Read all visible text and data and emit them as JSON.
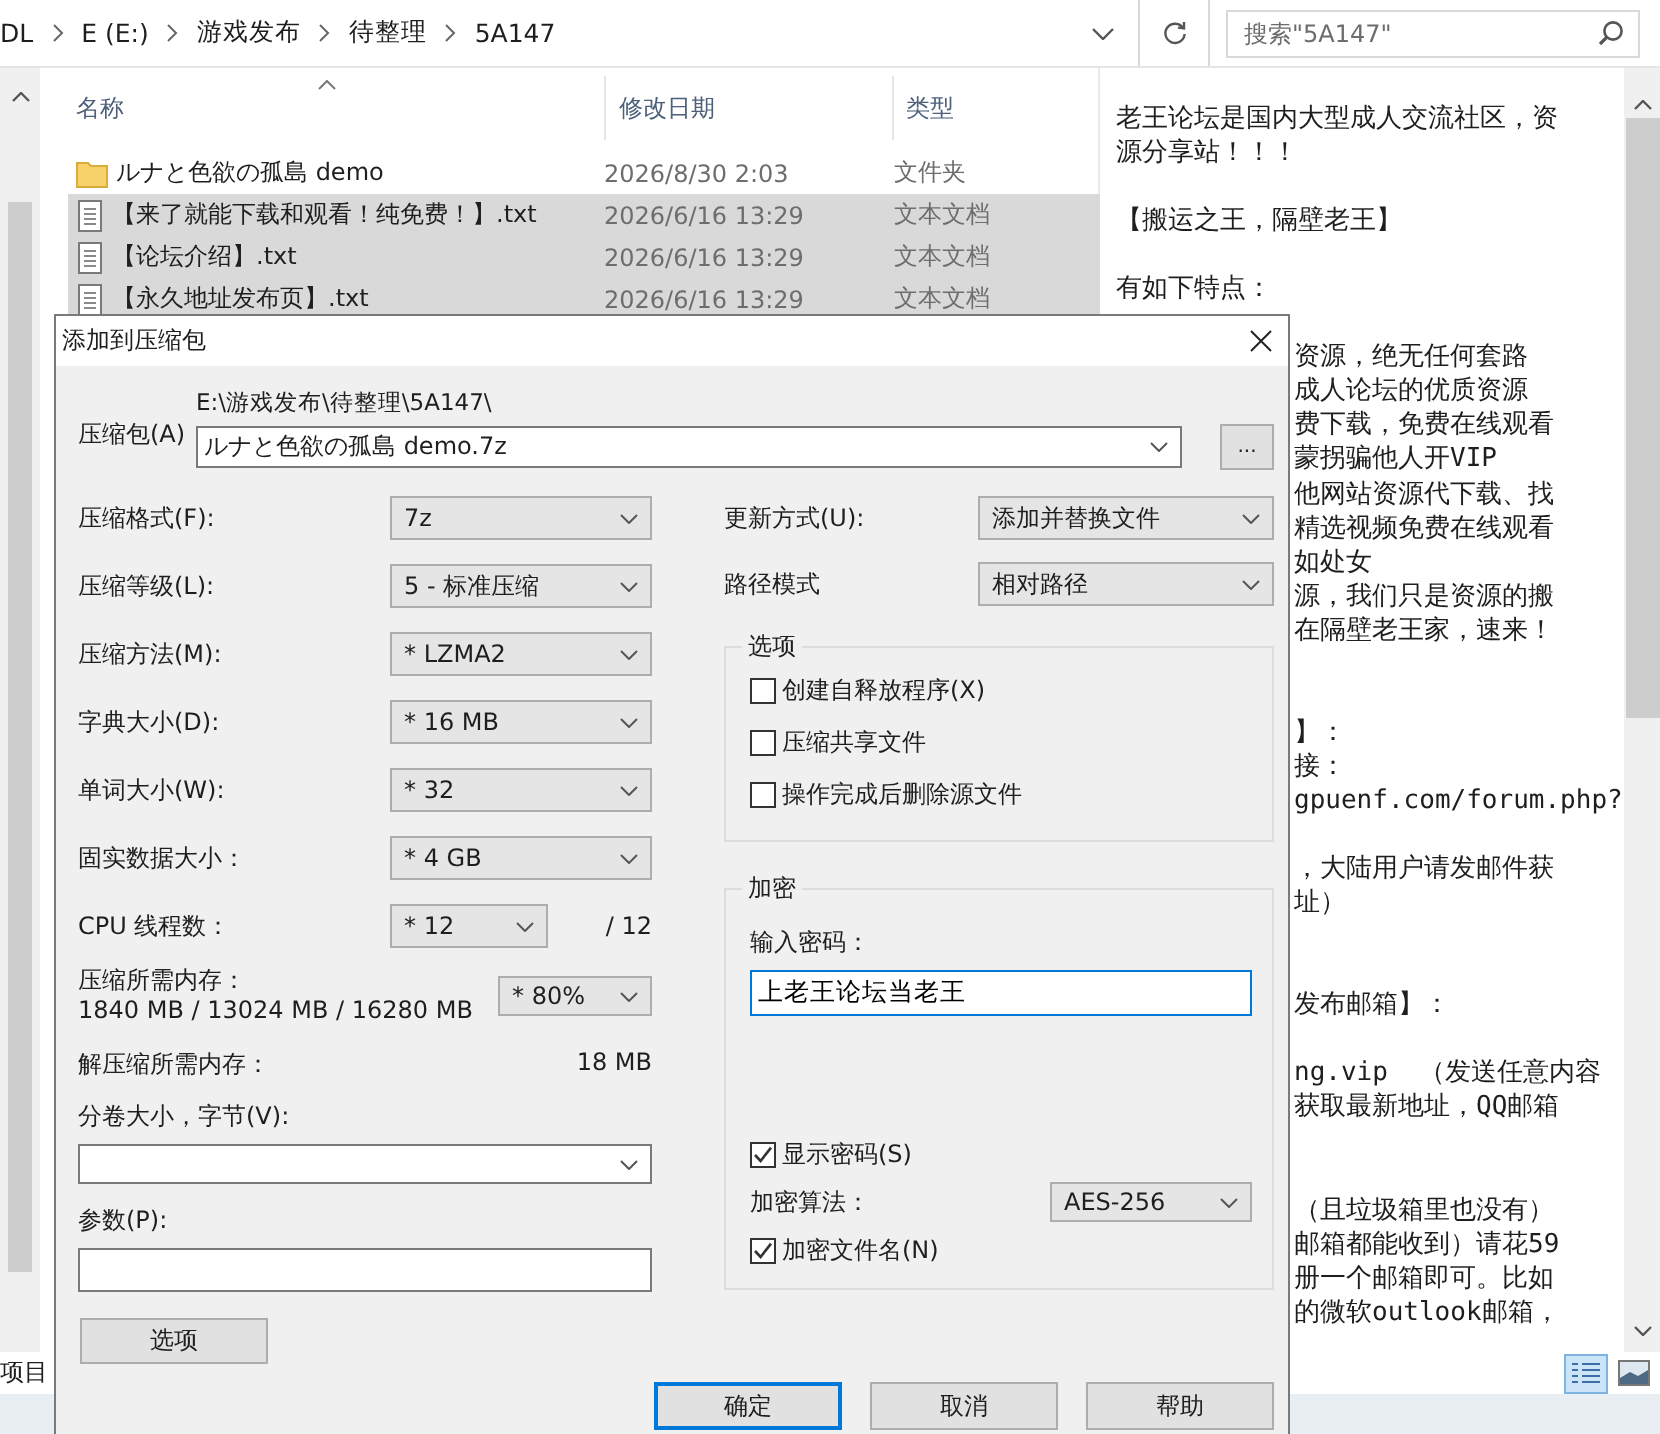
{
  "explorer": {
    "breadcrumb": [
      {
        "label": "DL"
      },
      {
        "label": "E (E:)"
      },
      {
        "label": "游戏发布"
      },
      {
        "label": "待整理"
      },
      {
        "label": "5A147"
      }
    ],
    "search": {
      "placeholder": "搜索\"5A147\""
    },
    "columns": [
      {
        "label": "名称",
        "sorted": true
      },
      {
        "label": "修改日期",
        "sorted": false
      },
      {
        "label": "类型",
        "sorted": false
      }
    ],
    "files": [
      {
        "name": "ルナと色欲の孤島 demo",
        "modified": "2026/8/30 2:03",
        "type": "文件夹",
        "kind": "folder",
        "selected": false
      },
      {
        "name": "【来了就能下载和观看！纯免费！】.txt",
        "modified": "2026/6/16 13:29",
        "type": "文本文档",
        "kind": "text",
        "selected": true
      },
      {
        "name": "【论坛介绍】.txt",
        "modified": "2026/6/16 13:29",
        "type": "文本文档",
        "kind": "text",
        "selected": true
      },
      {
        "name": "【永久地址发布页】.txt",
        "modified": "2026/6/16 13:29",
        "type": "文本文档",
        "kind": "text",
        "selected": true
      }
    ],
    "status_text": "项目",
    "preview": {
      "lines": [
        {
          "kind": "full",
          "text": "老王论坛是国内大型成人交流社区，资"
        },
        {
          "kind": "full",
          "text": "源分享站！！！"
        },
        {
          "kind": "blank"
        },
        {
          "kind": "full",
          "text": "【搬运之王，隔壁老王】"
        },
        {
          "kind": "blank"
        },
        {
          "kind": "full",
          "text": "有如下特点："
        },
        {
          "kind": "blank"
        },
        {
          "kind": "clipped",
          "text": "资源，绝无任何套路"
        },
        {
          "kind": "clipped",
          "text": "成人论坛的优质资源"
        },
        {
          "kind": "clipped",
          "text": "费下载，免费在线观看"
        },
        {
          "kind": "clipped",
          "text": "蒙拐骗他人开VIP"
        },
        {
          "kind": "clipped",
          "text": "他网站资源代下载、找"
        },
        {
          "kind": "clipped",
          "text": "精选视频免费在线观看"
        },
        {
          "kind": "clipped",
          "text": "如处女"
        },
        {
          "kind": "clipped",
          "text": "源，我们只是资源的搬"
        },
        {
          "kind": "clipped",
          "text": "在隔壁老王家，速来！"
        },
        {
          "kind": "blank"
        },
        {
          "kind": "blank"
        },
        {
          "kind": "clipped",
          "text": "】："
        },
        {
          "kind": "clipped",
          "text": "接："
        },
        {
          "kind": "clipped",
          "text": "gpuenf.com/forum.php?"
        },
        {
          "kind": "blank"
        },
        {
          "kind": "clipped",
          "text": "，大陆用户请发邮件获"
        },
        {
          "kind": "clipped",
          "text": "址）"
        },
        {
          "kind": "blank"
        },
        {
          "kind": "blank"
        },
        {
          "kind": "clipped",
          "text": "发布邮箱】："
        },
        {
          "kind": "blank"
        },
        {
          "kind": "clipped",
          "text": "ng.vip  （发送任意内容"
        },
        {
          "kind": "clipped",
          "text": "获取最新地址，QQ邮箱"
        },
        {
          "kind": "blank"
        },
        {
          "kind": "blank"
        },
        {
          "kind": "clipped",
          "text": "（且垃圾箱里也没有）"
        },
        {
          "kind": "clipped",
          "text": "邮箱都能收到）请花59"
        },
        {
          "kind": "clipped",
          "text": "册一个邮箱即可。比如"
        },
        {
          "kind": "clipped",
          "text": "的微软outlook邮箱，"
        }
      ]
    }
  },
  "dialog": {
    "title": "添加到压缩包",
    "archive": {
      "label": "压缩包(A)",
      "path": "E:\\游戏发布\\待整理\\5A147\\",
      "value": "ルナと色欲の孤島 demo.7z",
      "browse": "..."
    },
    "settings": [
      {
        "label": "压缩格式(F):",
        "value": "7z"
      },
      {
        "label": "压缩等级(L):",
        "value": "5 - 标准压缩"
      },
      {
        "label": "压缩方法(M):",
        "value": "* LZMA2"
      },
      {
        "label": "字典大小(D):",
        "value": "* 16 MB"
      },
      {
        "label": "单词大小(W):",
        "value": "* 32"
      },
      {
        "label": "固实数据大小：",
        "value": "* 4 GB"
      }
    ],
    "threads": {
      "label": "CPU 线程数：",
      "value": "* 12",
      "max": "/ 12"
    },
    "memory": {
      "label": "压缩所需内存：",
      "detail": "1840 MB / 13024 MB / 16280 MB",
      "value": "* 80%"
    },
    "decompress_memory": {
      "label": "解压缩所需内存：",
      "value": "18 MB"
    },
    "volume": {
      "label": "分卷大小，字节(V):"
    },
    "parameters": {
      "label": "参数(P):"
    },
    "options_button": "选项",
    "update_mode": {
      "label": "更新方式(U):",
      "value": "添加并替换文件"
    },
    "path_mode": {
      "label": "路径模式",
      "value": "相对路径"
    },
    "options": {
      "title": "选项",
      "items": [
        {
          "label": "创建自释放程序(X)",
          "checked": false
        },
        {
          "label": "压缩共享文件",
          "checked": false
        },
        {
          "label": "操作完成后删除源文件",
          "checked": false
        }
      ]
    },
    "encryption": {
      "title": "加密",
      "password_label": "输入密码：",
      "password": "上老王论坛当老王",
      "show_password": {
        "label": "显示密码(S)",
        "checked": true
      },
      "method": {
        "label": "加密算法：",
        "value": "AES-256"
      },
      "encrypt_names": {
        "label": "加密文件名(N)",
        "checked": true
      }
    },
    "buttons": [
      {
        "label": "确定",
        "default": true
      },
      {
        "label": "取消",
        "default": false
      },
      {
        "label": "帮助",
        "default": false
      }
    ]
  }
}
